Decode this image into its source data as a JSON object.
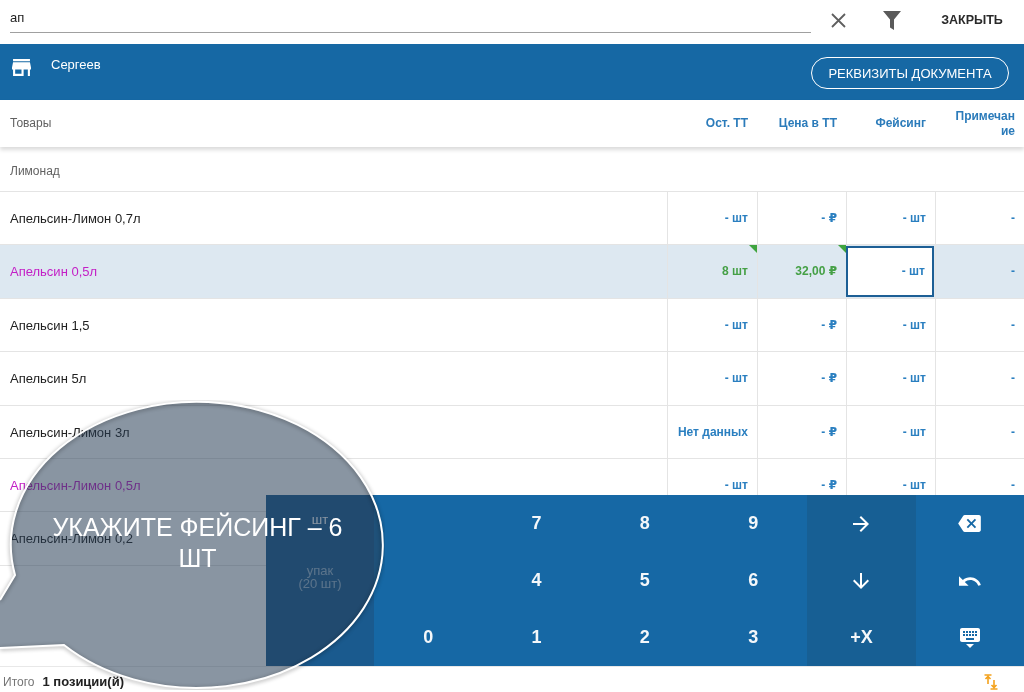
{
  "search": {
    "value": "ап"
  },
  "toolbar": {
    "close_label": "ЗАКРЫТЬ"
  },
  "header": {
    "store_name": "Сергеев",
    "details_button": "РЕКВИЗИТЫ ДОКУМЕНТА"
  },
  "table": {
    "columns": [
      "Товары",
      "Ост. ТТ",
      "Цена в ТТ",
      "Фейсинг",
      "Примечание"
    ],
    "group": "Лимонад",
    "rows": [
      {
        "name": "Апельсин-Лимон 0,7л",
        "highlighted": false,
        "selected": false,
        "cells": [
          {
            "text": "- шт",
            "entered": false,
            "focused": false
          },
          {
            "text": "- ₽",
            "entered": false,
            "focused": false
          },
          {
            "text": "- шт",
            "entered": false,
            "focused": false
          },
          {
            "text": "-",
            "entered": false,
            "focused": false
          }
        ]
      },
      {
        "name": "Апельсин 0,5л",
        "highlighted": true,
        "selected": true,
        "cells": [
          {
            "text": "8 шт",
            "entered": true,
            "focused": false
          },
          {
            "text": "32,00 ₽",
            "entered": true,
            "focused": false
          },
          {
            "text": "- шт",
            "entered": false,
            "focused": true
          },
          {
            "text": "-",
            "entered": false,
            "focused": false
          }
        ]
      },
      {
        "name": "Апельсин 1,5",
        "highlighted": false,
        "selected": false,
        "cells": [
          {
            "text": "- шт",
            "entered": false,
            "focused": false
          },
          {
            "text": "- ₽",
            "entered": false,
            "focused": false
          },
          {
            "text": "- шт",
            "entered": false,
            "focused": false
          },
          {
            "text": "-",
            "entered": false,
            "focused": false
          }
        ]
      },
      {
        "name": "Апельсин 5л",
        "highlighted": false,
        "selected": false,
        "cells": [
          {
            "text": "- шт",
            "entered": false,
            "focused": false
          },
          {
            "text": "- ₽",
            "entered": false,
            "focused": false
          },
          {
            "text": "- шт",
            "entered": false,
            "focused": false
          },
          {
            "text": "-",
            "entered": false,
            "focused": false
          }
        ]
      },
      {
        "name": "Апельсин-Лимон 3л",
        "highlighted": false,
        "selected": false,
        "cells": [
          {
            "text": "Нет данных",
            "entered": false,
            "focused": false
          },
          {
            "text": "- ₽",
            "entered": false,
            "focused": false
          },
          {
            "text": "- шт",
            "entered": false,
            "focused": false
          },
          {
            "text": "-",
            "entered": false,
            "focused": false
          }
        ]
      },
      {
        "name": "Апельсин-Лимон 0,5л",
        "highlighted": true,
        "selected": false,
        "cells": [
          {
            "text": "- шт",
            "entered": false,
            "focused": false
          },
          {
            "text": "- ₽",
            "entered": false,
            "focused": false
          },
          {
            "text": "- шт",
            "entered": false,
            "focused": false
          },
          {
            "text": "-",
            "entered": false,
            "focused": false
          }
        ]
      },
      {
        "name": "Апельсин-Лимон 0,2",
        "highlighted": false,
        "selected": false
      }
    ]
  },
  "keypad": {
    "unit_keys": [
      {
        "label": "шт",
        "selected": true
      },
      {
        "label": "упак",
        "sublabel": "(20 шт)",
        "selected": false
      }
    ],
    "rows": [
      [
        "",
        {
          "kind": "digit",
          "label": "7"
        },
        {
          "kind": "digit",
          "label": "8"
        },
        {
          "kind": "digit",
          "label": "9"
        },
        {
          "kind": "right"
        },
        {
          "kind": "backspace"
        }
      ],
      [
        "",
        {
          "kind": "digit",
          "label": "4"
        },
        {
          "kind": "digit",
          "label": "5"
        },
        {
          "kind": "digit",
          "label": "6"
        },
        {
          "kind": "down"
        },
        {
          "kind": "undo"
        }
      ],
      [
        {
          "kind": "digit",
          "label": "0"
        },
        {
          "kind": "digit",
          "label": "1"
        },
        {
          "kind": "digit",
          "label": "2"
        },
        {
          "kind": "digit",
          "label": "3"
        },
        {
          "kind": "multiply",
          "label": "+X"
        },
        {
          "kind": "keyboard"
        }
      ]
    ]
  },
  "hint": {
    "text": "УКАЖИТЕ ФЕЙСИНГ – 6 ШТ"
  },
  "footer": {
    "label": "Итого",
    "count": "1 позиции(й)"
  }
}
